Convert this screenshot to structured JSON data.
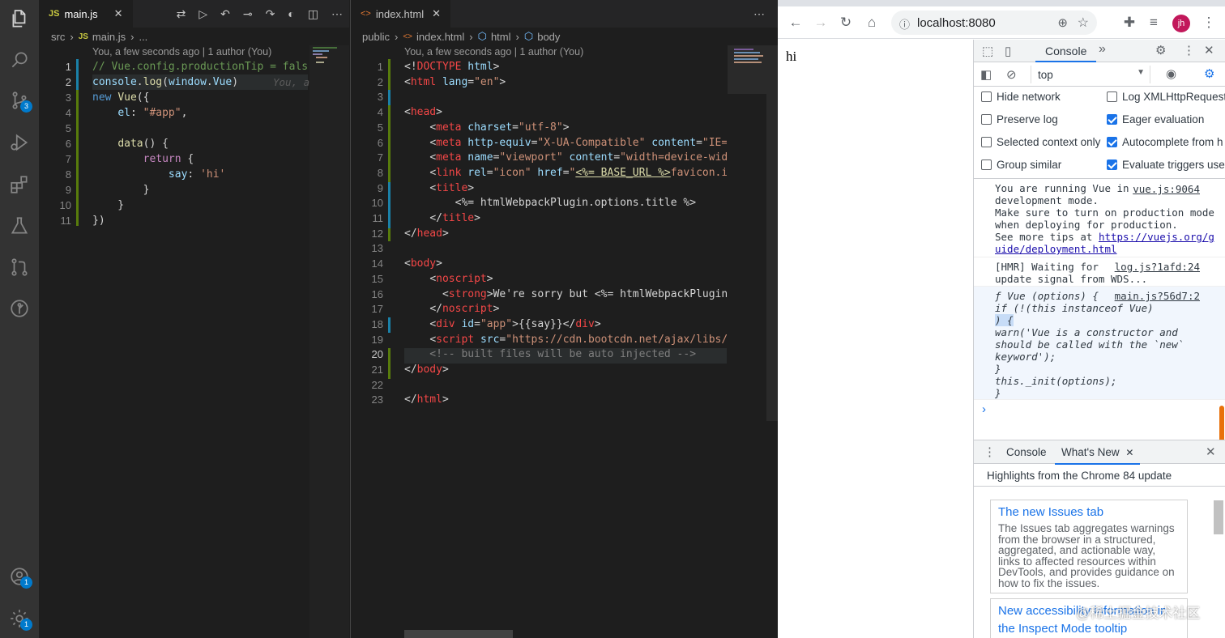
{
  "vscode": {
    "activity_bar": {
      "items": [
        {
          "icon": "files-icon",
          "badge": ""
        },
        {
          "icon": "search-icon",
          "badge": ""
        },
        {
          "icon": "source-control-icon",
          "badge": "3"
        },
        {
          "icon": "run-debug-icon",
          "badge": ""
        },
        {
          "icon": "extensions-icon",
          "badge": ""
        },
        {
          "icon": "test-flask-icon",
          "badge": ""
        },
        {
          "icon": "pull-requests-icon",
          "badge": ""
        },
        {
          "icon": "git-history-icon",
          "badge": ""
        }
      ],
      "bottom": [
        {
          "icon": "accounts-icon",
          "badge": "1"
        },
        {
          "icon": "settings-gear-icon",
          "badge": "1"
        }
      ]
    },
    "left_editor": {
      "tab_icon": "JS",
      "tab_label": "main.js",
      "close": "✕",
      "breadcrumb": [
        "src",
        "JS",
        "main.js",
        "..."
      ],
      "codelens": "You, a few seconds ago | 1 author (You)",
      "inline_blame": "You, a",
      "lines": [
        "// Vue.config.productionTip = false",
        "console.log(window.Vue)",
        "new Vue({",
        "    el: \"#app\",",
        "",
        "    data() {",
        "        return {",
        "            say: 'hi'",
        "        }",
        "    }",
        "})"
      ],
      "line_numbers": [
        "1",
        "2",
        "3",
        "4",
        "5",
        "6",
        "7",
        "8",
        "9",
        "10",
        "11"
      ]
    },
    "right_editor": {
      "tab_label": "index.html",
      "close": "✕",
      "breadcrumb": [
        "public",
        "index.html",
        "html",
        "body"
      ],
      "codelens": "You, a few seconds ago | 1 author (You)",
      "line_numbers": [
        "1",
        "2",
        "3",
        "4",
        "5",
        "6",
        "7",
        "8",
        "9",
        "10",
        "11",
        "12",
        "13",
        "14",
        "15",
        "16",
        "17",
        "18",
        "19",
        "20",
        "21",
        "22",
        "23"
      ],
      "lines": [
        "<!DOCTYPE html>",
        "<html lang=\"en\">",
        "",
        "<head>",
        "    <meta charset=\"utf-8\">",
        "    <meta http-equiv=\"X-UA-Compatible\" content=\"IE=ed",
        "    <meta name=\"viewport\" content=\"width=device-width",
        "    <link rel=\"icon\" href=\"<%= BASE_URL %>favicon.ico",
        "    <title>",
        "        <%= htmlWebpackPlugin.options.title %>",
        "    </title>",
        "</head>",
        "",
        "<body>",
        "    <noscript>",
        "      <strong>We're sorry but <%= htmlWebpackPlugin.o",
        "    </noscript>",
        "    <div id=\"app\">{{say}}</div>",
        "    <script src=\"https://cdn.bootcdn.net/ajax/libs/vu",
        "    <!-- built files will be auto injected -->",
        "</body>",
        "",
        "</html>"
      ]
    }
  },
  "browser": {
    "url": "localhost:8080",
    "profile": "jh",
    "page_text": "hi"
  },
  "devtools": {
    "main_tab": "Console",
    "context": "top",
    "settings": [
      {
        "label": "Hide network",
        "checked": false
      },
      {
        "label": "Log XMLHttpRequests",
        "checked": false
      },
      {
        "label": "Preserve log",
        "checked": false
      },
      {
        "label": "Eager evaluation",
        "checked": true
      },
      {
        "label": "Selected context only",
        "checked": false
      },
      {
        "label": "Autocomplete from h",
        "checked": true
      },
      {
        "label": "Group similar",
        "checked": false
      },
      {
        "label": "Evaluate triggers user",
        "checked": true
      }
    ],
    "messages": [
      {
        "source": "vue.js:9064",
        "lines": [
          "You are running Vue in",
          "development mode.",
          "Make sure to turn on production mode",
          "when deploying for production."
        ],
        "tip_prefix": "See more tips at ",
        "tip_link_1": "https://vuejs.org/g",
        "tip_link_2": "uide/deployment.html"
      },
      {
        "source": "log.js?1afd:24",
        "lines": [
          "[HMR] Waiting for",
          "update signal from WDS..."
        ]
      },
      {
        "source": "main.js?56d7:2",
        "lines": [
          "ƒ Vue (options) {",
          "    if (!(this instanceof Vue)",
          "    ) {",
          "      warn('Vue is a constructor and",
          "should be called with the `new`",
          "keyword');",
          "    }",
          "    this._init(options);",
          "  }"
        ]
      }
    ],
    "prompt": "›",
    "drawer": {
      "tabs": [
        "Console",
        "What's New"
      ],
      "close": "✕",
      "header": "Highlights from the Chrome 84 update",
      "cards": [
        {
          "title": "The new Issues tab",
          "body": "The Issues tab aggregates warnings from the browser in a structured, aggregated, and actionable way, links to affected resources within DevTools, and provides guidance on how to fix the issues."
        },
        {
          "title": "New accessibility information in",
          "title2": "the Inspect Mode tooltip"
        }
      ]
    }
  },
  "watermark": "@稀土掘金技术社区"
}
